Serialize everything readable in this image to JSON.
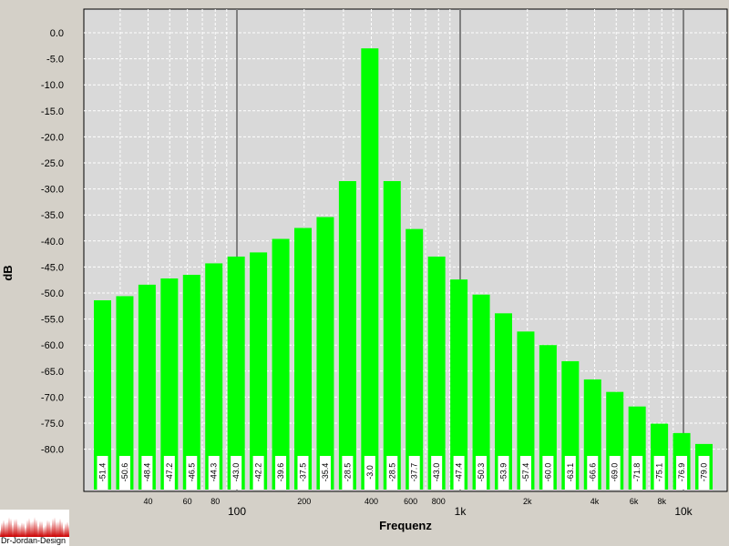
{
  "colors": {
    "background": "#d4d0c8",
    "plot_area": "#d9d9d9",
    "bar_fill": "#00ff00",
    "grid_minor": "#ffffff",
    "grid_major": "#808080",
    "logo_red": "#cc0000"
  },
  "logo": {
    "text": "Dr-Jordan-Design"
  },
  "chart_data": {
    "type": "bar",
    "xlabel": "Frequenz",
    "ylabel": "dB",
    "ylim": [
      -80,
      0
    ],
    "yticks": [
      "0.0",
      "-5.0",
      "-10.0",
      "-15.0",
      "-20.0",
      "-25.0",
      "-30.0",
      "-35.0",
      "-40.0",
      "-45.0",
      "-50.0",
      "-55.0",
      "-60.0",
      "-65.0",
      "-70.0",
      "-75.0",
      "-80.0"
    ],
    "xscale": "log",
    "minor_xticks": [
      "40",
      "60",
      "80",
      "200",
      "400",
      "600",
      "800",
      "2k",
      "4k",
      "6k",
      "8k"
    ],
    "major_xticks": [
      "100",
      "1k",
      "10k"
    ],
    "grid": true,
    "values": [
      -51.4,
      -50.6,
      -48.4,
      -47.2,
      -46.5,
      -44.3,
      -43.0,
      -42.2,
      -39.6,
      -37.5,
      -35.4,
      -28.5,
      -3.0,
      -28.5,
      -37.7,
      -43.0,
      -47.4,
      -50.3,
      -53.9,
      -57.4,
      -60.0,
      -63.1,
      -66.6,
      -69.0,
      -71.8,
      -75.1,
      -76.9,
      -79.0
    ],
    "value_labels": [
      "-51.4",
      "-50.6",
      "-48.4",
      "-47.2",
      "-46.5",
      "-44.3",
      "-43.0",
      "-42.2",
      "-39.6",
      "-37.5",
      "-35.4",
      "-28.5",
      "-3.0",
      "-28.5",
      "-37.7",
      "-43.0",
      "-47.4",
      "-50.3",
      "-53.9",
      "-57.4",
      "-60.0",
      "-63.1",
      "-66.6",
      "-69.0",
      "-71.8",
      "-75.1",
      "-76.9",
      "-79.0"
    ]
  }
}
